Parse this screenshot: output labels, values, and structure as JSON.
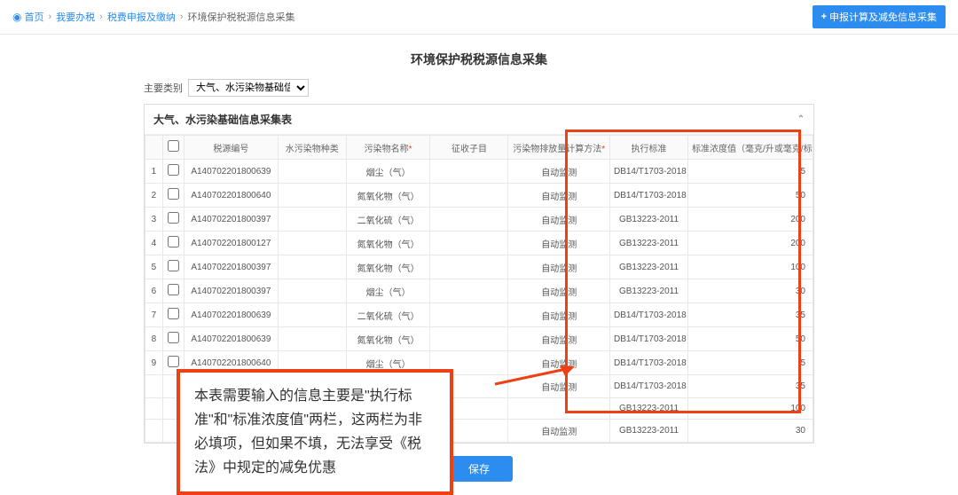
{
  "breadcrumb": {
    "home": "首页",
    "item1": "我要办税",
    "item2": "税费申报及缴纳",
    "current": "环境保护税税源信息采集"
  },
  "header_action": "申报计算及减免信息采集",
  "page_title": "环境保护税税源信息采集",
  "filter": {
    "label": "主要类别",
    "value": "大气、水污染物基础信息采集表"
  },
  "panel_title": "大气、水污染基础信息采集表",
  "columns": {
    "c1": "税源编号",
    "c2": "水污染物种类",
    "c3": "污染物名称",
    "c4": "征收子目",
    "c5": "污染物排放量计算方法",
    "c6": "执行标准",
    "c7": "标准浓度值（毫克/升或毫克/标立方米）"
  },
  "rows": [
    {
      "idx": "1",
      "code": "A140702201800639",
      "type": "",
      "name": "烟尘（气）",
      "sub": "",
      "method": "自动监测",
      "std": "DB14/T1703-2018",
      "val": "5"
    },
    {
      "idx": "2",
      "code": "A140702201800640",
      "type": "",
      "name": "氮氧化物（气）",
      "sub": "",
      "method": "自动监测",
      "std": "DB14/T1703-2018",
      "val": "50"
    },
    {
      "idx": "3",
      "code": "A140702201800397",
      "type": "",
      "name": "二氧化硫（气）",
      "sub": "",
      "method": "自动监测",
      "std": "GB13223-2011",
      "val": "200"
    },
    {
      "idx": "4",
      "code": "A140702201800127",
      "type": "",
      "name": "氮氧化物（气）",
      "sub": "",
      "method": "自动监测",
      "std": "GB13223-2011",
      "val": "200"
    },
    {
      "idx": "5",
      "code": "A140702201800397",
      "type": "",
      "name": "氮氧化物（气）",
      "sub": "",
      "method": "自动监测",
      "std": "GB13223-2011",
      "val": "100"
    },
    {
      "idx": "6",
      "code": "A140702201800397",
      "type": "",
      "name": "烟尘（气）",
      "sub": "",
      "method": "自动监测",
      "std": "GB13223-2011",
      "val": "30"
    },
    {
      "idx": "7",
      "code": "A140702201800639",
      "type": "",
      "name": "二氧化硫（气）",
      "sub": "",
      "method": "自动监测",
      "std": "DB14/T1703-2018",
      "val": "35"
    },
    {
      "idx": "8",
      "code": "A140702201800639",
      "type": "",
      "name": "氮氧化物（气）",
      "sub": "",
      "method": "自动监测",
      "std": "DB14/T1703-2018",
      "val": "50"
    },
    {
      "idx": "9",
      "code": "A140702201800640",
      "type": "",
      "name": "烟尘（气）",
      "sub": "",
      "method": "自动监测",
      "std": "DB14/T1703-2018",
      "val": "5"
    },
    {
      "idx": "",
      "code": "",
      "type": "",
      "name": "",
      "sub": "",
      "method": "自动监测",
      "std": "DB14/T1703-2018",
      "val": "35"
    },
    {
      "idx": "",
      "code": "",
      "type": "",
      "name": "",
      "sub": "",
      "method": "",
      "std": "GB13223-2011",
      "val": "100"
    },
    {
      "idx": "",
      "code": "",
      "type": "",
      "name": "",
      "sub": "",
      "method": "自动监测",
      "std": "GB13223-2011",
      "val": "30"
    }
  ],
  "annotation_text": "本表需要输入的信息主要是\"执行标准\"和\"标准浓度值\"两栏，这两栏为非必填项，但如果不填，无法享受《税法》中规定的减免优惠",
  "save_label": "保存"
}
